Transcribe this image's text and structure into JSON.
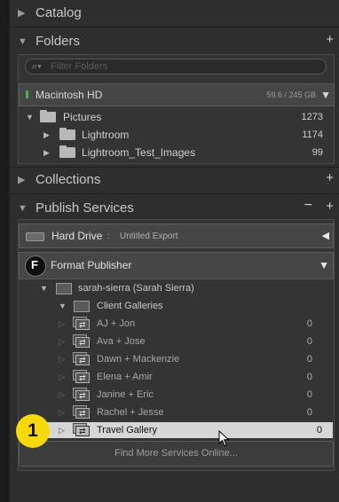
{
  "sections": {
    "catalog": {
      "title": "Catalog"
    },
    "folders": {
      "title": "Folders",
      "add": "+",
      "search_placeholder": "Filter Folders"
    },
    "collections": {
      "title": "Collections",
      "add": "+"
    },
    "publish": {
      "title": "Publish Services",
      "minus": "−",
      "add": "+"
    }
  },
  "volume": {
    "name": "Macintosh HD",
    "space": "59.6 / 245 GB",
    "status_color": "#4caf50"
  },
  "folders": [
    {
      "name": "Pictures",
      "count": "1273"
    },
    {
      "name": "Lightroom",
      "count": "1174"
    },
    {
      "name": "Lightroom_Test_Images",
      "count": "99"
    }
  ],
  "services": {
    "hard_drive": {
      "name": "Hard Drive",
      "sep": " : ",
      "sub": "Untitled Export"
    },
    "format": {
      "logo": "F",
      "name": "Format Publisher"
    },
    "account": "sarah-sierra (Sarah Sierra)",
    "set": "Client Galleries",
    "galleries": [
      {
        "name": "AJ + Jon",
        "count": "0"
      },
      {
        "name": "Ava + Jose",
        "count": "0"
      },
      {
        "name": "Dawn + Mackenzie",
        "count": "0"
      },
      {
        "name": "Elena + Amir",
        "count": "0"
      },
      {
        "name": "Janine + Eric",
        "count": "0"
      },
      {
        "name": "Rachel + Jesse",
        "count": "0"
      }
    ],
    "selected": {
      "name": "Travel Gallery",
      "count": "0"
    },
    "find_more": "Find More Services Online..."
  },
  "callout": {
    "label": "1",
    "color": "#f5d90a"
  },
  "colors": {
    "panel_bg": "#2e2e2e",
    "selected_row": "#d6d6d6"
  }
}
